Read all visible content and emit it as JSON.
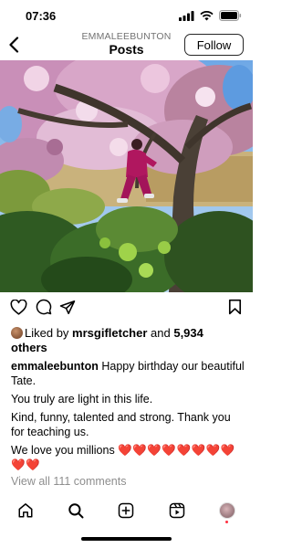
{
  "status_bar": {
    "time": "07:36"
  },
  "header": {
    "username": "EMMALEEBUNTON",
    "title": "Posts",
    "follow_label": "Follow"
  },
  "post": {
    "image_alt": "Child in magenta outfit climbing a blossoming magnolia tree above green shrubs",
    "likes": {
      "prefix": "Liked by ",
      "user": "mrsgifletcher",
      "middle": " and ",
      "count": "5,934",
      "suffix": "others"
    },
    "caption": {
      "author": "emmaleebunton",
      "line1": "Happy birthday our beautiful Tate.",
      "line2": "You truly are light in this life.",
      "line3": "Kind, funny, talented and strong. Thank you for teaching us.",
      "line4": "We love you millions",
      "hearts": "❤️❤️❤️❤️❤️❤️❤️❤️❤️❤️"
    },
    "comments_link": "View all 111 comments"
  },
  "icons": {
    "back": "chevron-left-icon",
    "like": "heart-icon",
    "comment": "comment-icon",
    "share": "send-icon",
    "save": "bookmark-icon",
    "home": "home-icon",
    "search": "search-icon",
    "create": "plus-square-icon",
    "reels": "reels-icon",
    "profile": "profile-avatar"
  },
  "colors": {
    "hearts": "#e0252b",
    "muted": "#8e8e8e",
    "notification_dot": "#ff3040"
  }
}
